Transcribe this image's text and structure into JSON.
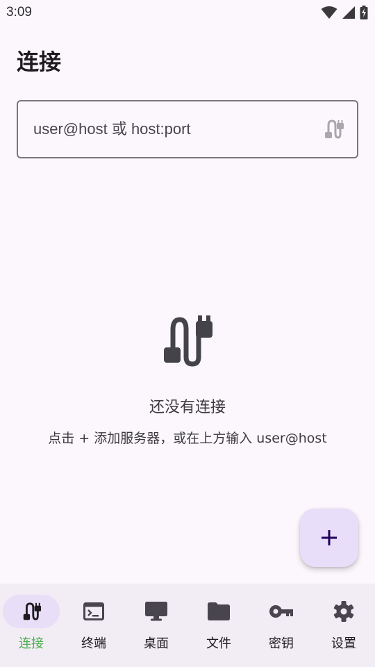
{
  "status_bar": {
    "time": "3:09"
  },
  "page": {
    "title": "连接"
  },
  "search": {
    "placeholder": "user@host 或 host:port",
    "trailing_icon": "cable-icon"
  },
  "empty_state": {
    "icon": "cable-icon",
    "title": "还没有连接",
    "subtitle": "点击 + 添加服务器，或在上方输入 user@host"
  },
  "fab": {
    "icon": "plus-icon",
    "label": "+"
  },
  "bottom_nav": {
    "items": [
      {
        "label": "连接",
        "icon": "cable-icon",
        "active": true
      },
      {
        "label": "终端",
        "icon": "terminal-icon",
        "active": false
      },
      {
        "label": "桌面",
        "icon": "monitor-icon",
        "active": false
      },
      {
        "label": "文件",
        "icon": "folder-icon",
        "active": false
      },
      {
        "label": "密钥",
        "icon": "key-icon",
        "active": false
      },
      {
        "label": "设置",
        "icon": "gear-icon",
        "active": false
      }
    ]
  },
  "colors": {
    "background": "#fcf7fd",
    "accent_green": "#4caf50",
    "active_indicator": "#e8def8",
    "fab_background": "#e9def9",
    "nav_background": "#f2ecf4"
  }
}
